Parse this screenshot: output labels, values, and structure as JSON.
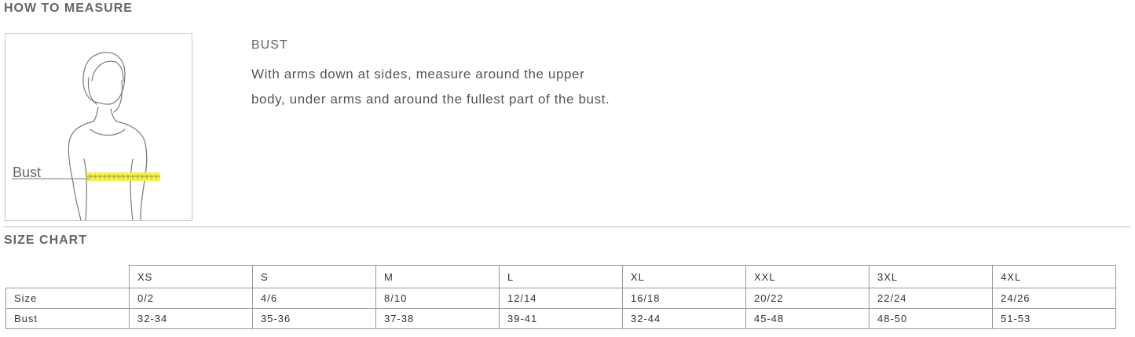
{
  "how_to_measure": {
    "title": "HOW TO MEASURE",
    "figure_label": "Bust",
    "heading": "BUST",
    "description": "With arms down at sides, measure around the upper body, under arms and around the fullest part of the bust."
  },
  "size_chart": {
    "title": "SIZE CHART",
    "sizes": [
      "XS",
      "S",
      "M",
      "L",
      "XL",
      "XXL",
      "3XL",
      "4XL"
    ],
    "rows": [
      {
        "label": "Size",
        "values": [
          "0/2",
          "4/6",
          "8/10",
          "12/14",
          "16/18",
          "20/22",
          "22/24",
          "24/26"
        ]
      },
      {
        "label": "Bust",
        "values": [
          "32-34",
          "35-36",
          "37-38",
          "39-41",
          "32-44",
          "45-48",
          "48-50",
          "51-53"
        ]
      }
    ]
  },
  "colors": {
    "tape": "#f3f03a",
    "outline": "#7a7a7a"
  }
}
